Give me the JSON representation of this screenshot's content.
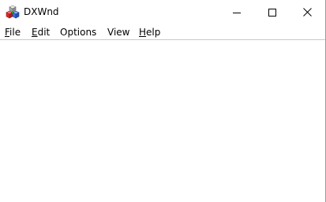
{
  "window": {
    "title": "DXWnd",
    "icon": "dxwnd-app-icon"
  },
  "caption_buttons": [
    "minimize-icon",
    "maximize-icon",
    "close-icon"
  ],
  "menu": {
    "items": [
      {
        "label": "File",
        "access_key": "F",
        "rest": "ile"
      },
      {
        "label": "Edit",
        "access_key": "E",
        "rest": "dit"
      },
      {
        "label": "Options",
        "access_key": "",
        "rest": "Options"
      },
      {
        "label": "View",
        "access_key": "",
        "rest": "View"
      },
      {
        "label": "Help",
        "access_key": "H",
        "rest": "elp"
      }
    ]
  }
}
